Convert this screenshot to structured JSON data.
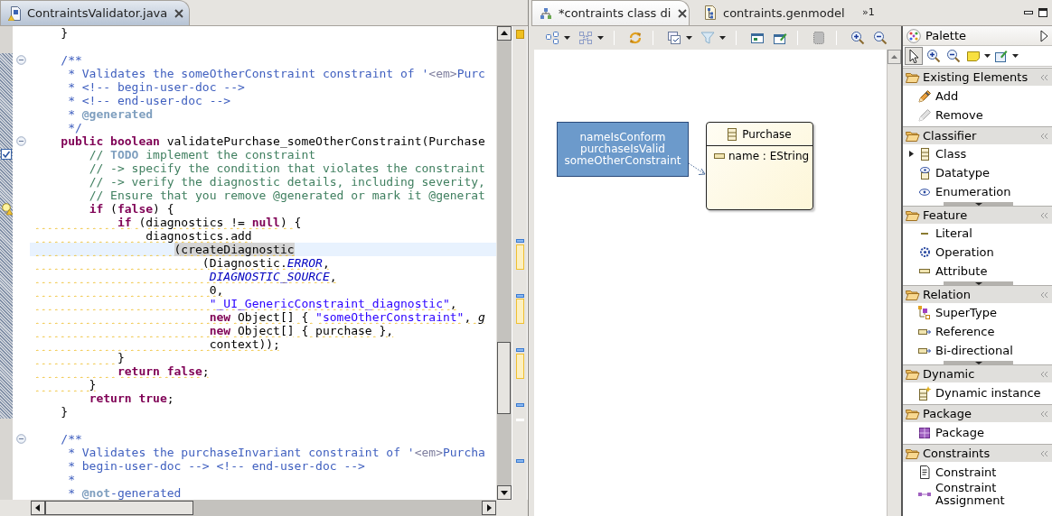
{
  "editor": {
    "active": true,
    "tabs": [
      {
        "title": "ContraintsValidator.java",
        "selected": true,
        "kind": "java"
      }
    ],
    "blocks": [
      {
        "in_range": false,
        "lines": [
          {
            "kind": "plain",
            "segments": [
              {
                "kind": "plain",
                "text": "    }"
              }
            ],
            "fold": false,
            "warning": false,
            "current": false
          },
          {
            "kind": "plain",
            "fold": false,
            "current": false
          }
        ]
      },
      {
        "in_range": true,
        "lines": [
          {
            "kind": "plain",
            "segments": [
              {
                "kind": "doc",
                "text": "    /**"
              }
            ],
            "fold": true,
            "warning": false,
            "current": false
          },
          {
            "kind": "plain",
            "segments": [
              {
                "kind": "doc",
                "text": "     * Validates the someOtherConstraint constraint of '"
              },
              {
                "kind": "html",
                "text": "<em>"
              },
              {
                "kind": "doc",
                "text": "Purc"
              }
            ],
            "fold": false,
            "warning": false,
            "current": false
          },
          {
            "kind": "plain",
            "segments": [
              {
                "kind": "doc",
                "text": "     * <!-- begin-user-doc -->"
              }
            ],
            "fold": false,
            "warning": false,
            "current": false
          },
          {
            "kind": "plain",
            "segments": [
              {
                "kind": "doc",
                "text": "     * <!-- end-user-doc -->"
              }
            ],
            "fold": false,
            "warning": false,
            "current": false
          },
          {
            "kind": "plain",
            "segments": [
              {
                "kind": "doc",
                "text": "     *"
              },
              {
                "kind": "doc-tag",
                "text": " @generated"
              }
            ],
            "fold": false,
            "warning": false,
            "current": false
          },
          {
            "kind": "plain",
            "segments": [
              {
                "kind": "doc",
                "text": "     */"
              }
            ],
            "fold": false,
            "warning": false,
            "current": false
          },
          {
            "kind": "plain",
            "segments": [
              {
                "kind": "keyword",
                "text": "    public boolean"
              },
              {
                "kind": "plain",
                "text": " validatePurchase_someOtherConstraint(Purchase"
              }
            ],
            "fold": true,
            "warning": false,
            "current": false
          },
          {
            "kind": "task",
            "segments": [
              {
                "kind": "comment",
                "text": "        //"
              },
              {
                "kind": "todo",
                "text": " TODO"
              },
              {
                "kind": "comment",
                "text": " implement the constraint"
              }
            ],
            "fold": false,
            "warning": false,
            "current": false
          },
          {
            "kind": "plain",
            "segments": [
              {
                "kind": "comment",
                "text": "        // -> specify the condition that violates the constraint"
              }
            ],
            "fold": false,
            "warning": false,
            "current": false
          },
          {
            "kind": "plain",
            "segments": [
              {
                "kind": "comment",
                "text": "        // -> verify the diagnostic details, including severity,"
              }
            ],
            "fold": false,
            "warning": false,
            "current": false
          },
          {
            "kind": "plain",
            "segments": [
              {
                "kind": "comment",
                "text": "        // Ensure that you remove @generated or mark it @generat"
              }
            ],
            "fold": false,
            "warning": false,
            "current": false
          },
          {
            "kind": "quickfix",
            "segments": [
              {
                "kind": "keyword",
                "text": "        if"
              },
              {
                "kind": "plain",
                "text": " ("
              },
              {
                "kind": "keyword",
                "text": "false"
              },
              {
                "kind": "plain",
                "text": ") {"
              }
            ],
            "fold": false,
            "warning": false,
            "current": false
          },
          {
            "kind": "plain",
            "segments": [
              {
                "kind": "keyword",
                "text": "            if"
              },
              {
                "kind": "plain",
                "text": " (diagnostics != "
              },
              {
                "kind": "keyword",
                "text": "null"
              },
              {
                "kind": "plain",
                "text": ") {"
              }
            ],
            "fold": false,
            "warning": true,
            "current": false
          },
          {
            "kind": "plain",
            "segments": [
              {
                "kind": "plain",
                "text": "                diagnostics.add"
              }
            ],
            "fold": false,
            "warning": true,
            "current": false
          },
          {
            "kind": "plain",
            "segments": [
              {
                "kind": "occurrence",
                "text": "                    (createDiagnostic"
              }
            ],
            "fold": false,
            "warning": true,
            "current": true
          },
          {
            "kind": "plain",
            "segments": [
              {
                "kind": "plain",
                "text": "                        (Diagnostic."
              },
              {
                "kind": "constant",
                "text": "ERROR"
              },
              {
                "kind": "plain",
                "text": ","
              }
            ],
            "fold": false,
            "warning": true,
            "current": false
          },
          {
            "kind": "plain",
            "segments": [
              {
                "kind": "constant",
                "text": "                         DIAGNOSTIC_SOURCE"
              },
              {
                "kind": "plain",
                "text": ","
              }
            ],
            "fold": false,
            "warning": true,
            "current": false
          },
          {
            "kind": "plain",
            "segments": [
              {
                "kind": "plain",
                "text": "                         0,"
              }
            ],
            "fold": false,
            "warning": true,
            "current": false
          },
          {
            "kind": "plain",
            "segments": [
              {
                "kind": "string",
                "text": "                         \"_UI_GenericConstraint_diagnostic\""
              },
              {
                "kind": "plain",
                "text": ","
              }
            ],
            "fold": false,
            "warning": true,
            "current": false
          },
          {
            "kind": "plain",
            "segments": [
              {
                "kind": "keyword",
                "text": "                         new"
              },
              {
                "kind": "plain",
                "text": " Object[] { "
              },
              {
                "kind": "string",
                "text": "\"someOtherConstraint\""
              },
              {
                "kind": "plain",
                "text": ", "
              },
              {
                "kind": "static",
                "text": "g"
              }
            ],
            "fold": false,
            "warning": true,
            "current": false
          },
          {
            "kind": "plain",
            "segments": [
              {
                "kind": "keyword",
                "text": "                         new"
              },
              {
                "kind": "plain",
                "text": " Object[] { purchase },"
              }
            ],
            "fold": false,
            "warning": true,
            "current": false
          },
          {
            "kind": "plain",
            "segments": [
              {
                "kind": "plain",
                "text": "                         context));"
              }
            ],
            "fold": false,
            "warning": true,
            "current": false
          },
          {
            "kind": "plain",
            "segments": [
              {
                "kind": "plain",
                "text": "            }"
              }
            ],
            "fold": false,
            "warning": true,
            "current": false
          },
          {
            "kind": "plain",
            "segments": [
              {
                "kind": "keyword",
                "text": "            return false"
              },
              {
                "kind": "plain",
                "text": ";"
              }
            ],
            "fold": false,
            "warning": true,
            "current": false
          },
          {
            "kind": "plain",
            "segments": [
              {
                "kind": "plain",
                "text": "        }"
              }
            ],
            "fold": false,
            "warning": true,
            "current": false
          },
          {
            "kind": "plain",
            "segments": [
              {
                "kind": "keyword",
                "text": "        return true"
              },
              {
                "kind": "plain",
                "text": ";"
              }
            ],
            "fold": false,
            "warning": false,
            "current": false
          },
          {
            "kind": "plain",
            "segments": [
              {
                "kind": "plain",
                "text": "    }"
              }
            ],
            "fold": false,
            "warning": false,
            "current": false
          }
        ]
      },
      {
        "in_range": false,
        "lines": [
          {
            "kind": "plain",
            "fold": false,
            "current": false
          },
          {
            "kind": "plain",
            "segments": [
              {
                "kind": "doc",
                "text": "    /**"
              }
            ],
            "fold": true,
            "warning": false,
            "current": false
          },
          {
            "kind": "plain",
            "segments": [
              {
                "kind": "doc",
                "text": "     * Validates the purchaseInvariant constraint of '"
              },
              {
                "kind": "html",
                "text": "<em>"
              },
              {
                "kind": "doc",
                "text": "Purcha"
              }
            ],
            "fold": false,
            "warning": false,
            "current": false
          },
          {
            "kind": "plain",
            "segments": [
              {
                "kind": "doc",
                "text": "     * begin-user-doc --> <!-- end-user-doc -->"
              }
            ],
            "fold": false,
            "warning": false,
            "current": false
          },
          {
            "kind": "plain",
            "segments": [
              {
                "kind": "doc",
                "text": "     *"
              }
            ],
            "fold": false,
            "warning": false,
            "current": false
          },
          {
            "kind": "plain",
            "segments": [
              {
                "kind": "doc",
                "text": "     *"
              },
              {
                "kind": "doc-tag",
                "text": " @not"
              },
              {
                "kind": "doc",
                "text": "-generated"
              }
            ],
            "fold": false,
            "warning": false,
            "current": false
          }
        ]
      }
    ]
  },
  "diagram": {
    "active": false,
    "tabs": [
      {
        "title": "*contraints class di",
        "selected": true,
        "kind": "diagram"
      },
      {
        "title": "contraints.genmodel",
        "selected": false,
        "kind": "genmodel"
      }
    ],
    "more_tabs": "»1",
    "nodes": [
      {
        "kind": "constraint",
        "lines": [
          "nameIsConform",
          "purchaseIsValid",
          "someOtherConstraint"
        ]
      },
      {
        "kind": "class",
        "name": "Purchase",
        "attributes": [
          "name : EString"
        ]
      }
    ]
  },
  "palette": {
    "title": "Palette",
    "tools": [
      {
        "kind": "select",
        "selected": true
      },
      {
        "kind": "zoom-in",
        "selected": false
      },
      {
        "kind": "zoom-out",
        "selected": false
      },
      {
        "kind": "note",
        "selected": false
      },
      {
        "kind": "note-attachment",
        "selected": false
      }
    ],
    "drawers": [
      {
        "name": "Existing Elements",
        "clipped": false,
        "items": [
          {
            "label": "Add",
            "kind": "add",
            "stack": false
          },
          {
            "label": "Remove",
            "kind": "remove",
            "stack": false
          }
        ]
      },
      {
        "name": "Classifier",
        "clipped": true,
        "items": [
          {
            "label": "Class",
            "kind": "class",
            "stack": true
          },
          {
            "label": "Datatype",
            "kind": "datatype",
            "stack": false
          },
          {
            "label": "Enumeration",
            "kind": "enumeration",
            "stack": false
          }
        ]
      },
      {
        "name": "Feature",
        "clipped": true,
        "items": [
          {
            "label": "Literal",
            "kind": "literal",
            "stack": false
          },
          {
            "label": "Operation",
            "kind": "operation",
            "stack": false
          },
          {
            "label": "Attribute",
            "kind": "attribute",
            "stack": false
          }
        ]
      },
      {
        "name": "Relation",
        "clipped": true,
        "items": [
          {
            "label": "SuperType",
            "kind": "supertype",
            "stack": false
          },
          {
            "label": "Reference",
            "kind": "reference",
            "stack": false
          },
          {
            "label": "Bi-directional",
            "kind": "bidirectional",
            "stack": false
          }
        ]
      },
      {
        "name": "Dynamic",
        "clipped": false,
        "items": [
          {
            "label": "Dynamic instance",
            "kind": "dynamic",
            "stack": false
          }
        ]
      },
      {
        "name": "Package",
        "clipped": false,
        "items": [
          {
            "label": "Package",
            "kind": "package",
            "stack": false
          }
        ]
      },
      {
        "name": "Constraints",
        "clipped": false,
        "items": [
          {
            "label": "Constraint",
            "kind": "constraint",
            "stack": false
          },
          {
            "label": "Constraint Assignment",
            "kind": "assignment",
            "stack": false
          }
        ]
      }
    ]
  }
}
